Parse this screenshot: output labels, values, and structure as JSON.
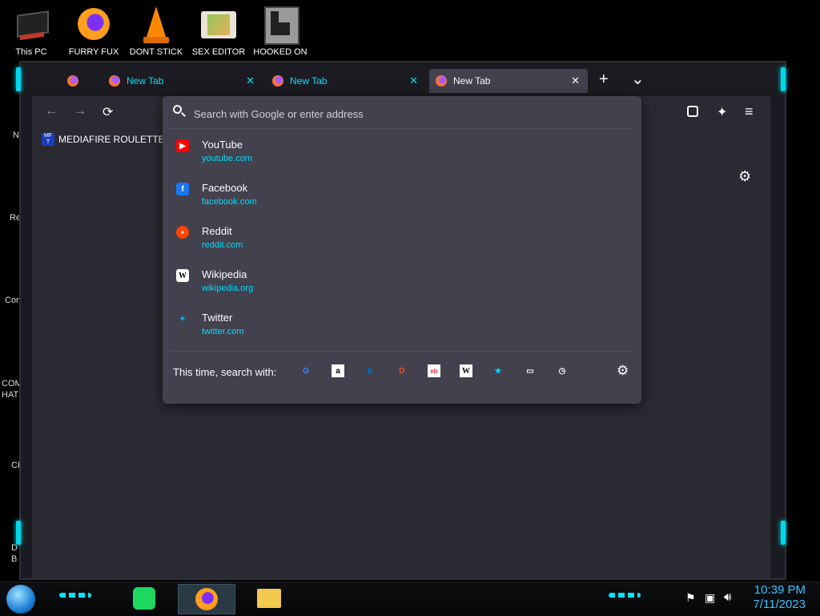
{
  "desktop": {
    "icons": [
      {
        "label": "This PC",
        "icon": "computer-icon"
      },
      {
        "label": "FURRY FUX",
        "icon": "firefox-icon"
      },
      {
        "label": "DONT STICK",
        "icon": "vlc-cone-icon"
      },
      {
        "label": "SEX EDITOR",
        "icon": "hxd-editor-icon"
      },
      {
        "label": "HOOKED ON",
        "icon": "game-icon"
      }
    ],
    "left_partial_labels": [
      "N",
      "Re",
      "Con",
      "COM",
      "HATE",
      "CH",
      "D",
      "B"
    ]
  },
  "browser": {
    "tabs": [
      {
        "label": "",
        "active": false
      },
      {
        "label": "New Tab",
        "active": false
      },
      {
        "label": "New Tab",
        "active": false
      },
      {
        "label": "New Tab",
        "active": true
      }
    ],
    "new_tab_symbol": "+",
    "list_all_tabs_symbol": "⌄",
    "bookmarks": [
      {
        "label": "MEDIAFIRE ROULETTER",
        "badge": "MF T"
      }
    ],
    "urlbar": {
      "placeholder": "Search with Google or enter address",
      "value": ""
    },
    "suggestions": [
      {
        "title": "YouTube",
        "url": "youtube.com",
        "icon": "youtube-icon",
        "color": "#ff0000"
      },
      {
        "title": "Facebook",
        "url": "facebook.com",
        "icon": "facebook-icon",
        "color": "#1877f2"
      },
      {
        "title": "Reddit",
        "url": "reddit.com",
        "icon": "reddit-icon",
        "color": "#ff4500"
      },
      {
        "title": "Wikipedia",
        "url": "wikipedia.org",
        "icon": "wikipedia-icon",
        "color": "#ffffff"
      },
      {
        "title": "Twitter",
        "url": "twitter.com",
        "icon": "twitter-icon",
        "color": "#1da1f2"
      }
    ],
    "search_with_label": "This time, search with:",
    "engines": [
      {
        "name": "google-icon",
        "glyph": "G",
        "color": "#4285f4"
      },
      {
        "name": "amazon-icon",
        "glyph": "a",
        "color": "#ff9900"
      },
      {
        "name": "bing-icon",
        "glyph": "b",
        "color": "#0078d7"
      },
      {
        "name": "duckduckgo-icon",
        "glyph": "D",
        "color": "#de5833"
      },
      {
        "name": "ebay-icon",
        "glyph": "eb",
        "color": "#e53238"
      },
      {
        "name": "wikipedia-icon",
        "glyph": "W",
        "color": "#ffffff"
      },
      {
        "name": "bookmarks-star-icon",
        "glyph": "★",
        "color": "#00ddff"
      },
      {
        "name": "tabs-icon",
        "glyph": "▭",
        "color": "#fbfbfe"
      },
      {
        "name": "history-icon",
        "glyph": "◷",
        "color": "#fbfbfe"
      }
    ]
  },
  "taskbar": {
    "time": "10:39 PM",
    "date": "7/11/2023"
  },
  "colors": {
    "accent": "#00ddff",
    "popup_bg": "#42414d",
    "toolbar_bg": "#2b2a33",
    "clock": "#35c5ff"
  }
}
